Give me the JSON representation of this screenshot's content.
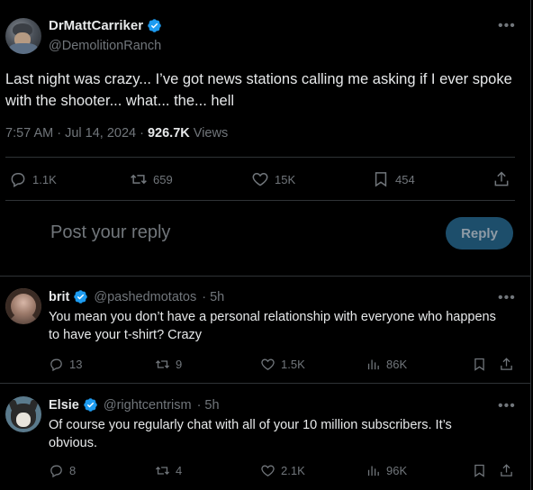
{
  "tweet": {
    "display_name": "DrMattCarriker",
    "handle": "@DemolitionRanch",
    "text": "Last night was crazy... I’ve got news stations calling me asking if I ever spoke with the shooter... what... the... hell",
    "timestamp": "7:57 AM · Jul 14, 2024 · ",
    "views_count": "926.7K",
    "views_label": " Views",
    "actions": {
      "replies": "1.1K",
      "retweets": "659",
      "likes": "15K",
      "bookmarks": "454"
    }
  },
  "reply_composer": {
    "placeholder": "Post your reply",
    "button_label": "Reply"
  },
  "replies": [
    {
      "display_name": "brit",
      "handle": "@pashedmotatos",
      "time": "· 5h",
      "text": "You mean you don’t have a personal relationship with everyone who happens to have your t-shirt? Crazy",
      "replies": "13",
      "retweets": "9",
      "likes": "1.5K",
      "views": "86K"
    },
    {
      "display_name": "Elsie",
      "handle": "@rightcentrism",
      "time": "· 5h",
      "text": "Of course you regularly chat with all of your 10 million subscribers. It’s obvious.",
      "replies": "8",
      "retweets": "4",
      "likes": "2.1K",
      "views": "96K"
    }
  ],
  "icons": {
    "more": "•••",
    "verified_color": "#1d9bf0"
  }
}
